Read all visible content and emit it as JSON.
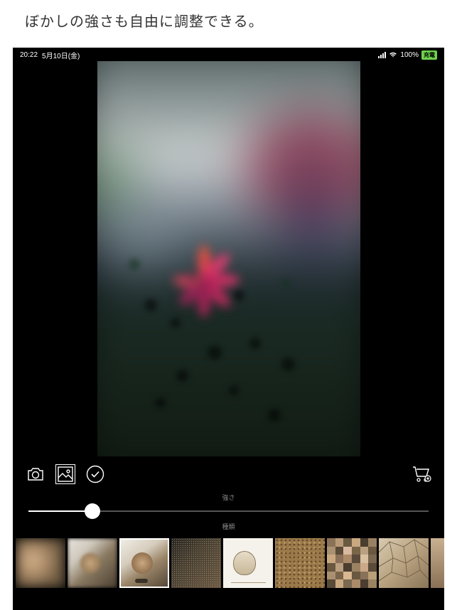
{
  "caption": "ぼかしの強さも自由に調整できる。",
  "status_bar": {
    "time": "20:22",
    "date": "5月10日(金)",
    "battery_percent": "100%",
    "battery_badge": "充電"
  },
  "tools": {
    "camera": "camera",
    "gallery": "gallery",
    "confirm": "confirm",
    "cart": "cart"
  },
  "slider": {
    "label": "強さ",
    "value_percent": 16
  },
  "filters": {
    "label": "種類",
    "selected_index": 2,
    "items": [
      {
        "name": "blur-heavy"
      },
      {
        "name": "blur-soft"
      },
      {
        "name": "blur-light"
      },
      {
        "name": "noise"
      },
      {
        "name": "sketch"
      },
      {
        "name": "dots"
      },
      {
        "name": "mosaic"
      },
      {
        "name": "crystal"
      }
    ]
  }
}
